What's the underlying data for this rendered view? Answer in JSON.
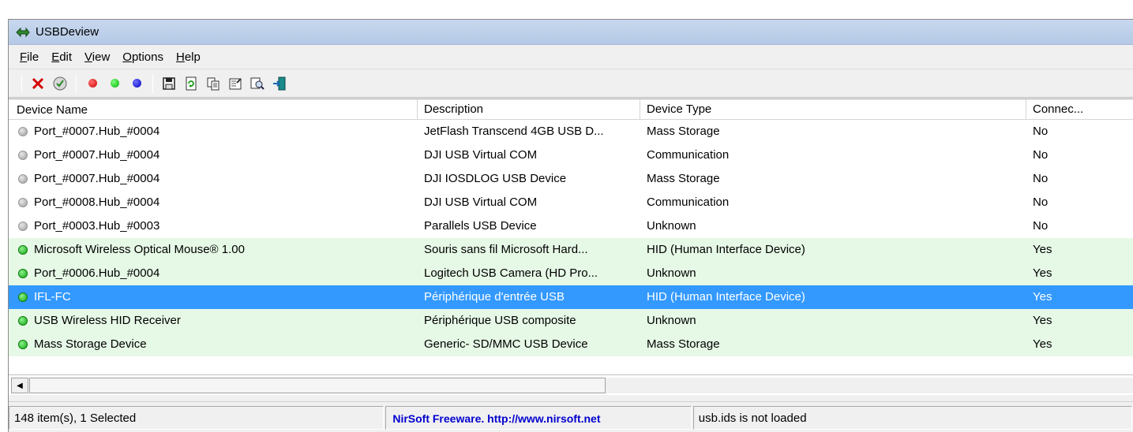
{
  "window": {
    "title": "USBDeview"
  },
  "menu": [
    "File",
    "Edit",
    "View",
    "Options",
    "Help"
  ],
  "menu_accels": [
    "F",
    "E",
    "V",
    "O",
    "H"
  ],
  "toolbar": [
    {
      "name": "uninstall-icon"
    },
    {
      "name": "disable-icon"
    },
    {
      "name": "red-dot-icon",
      "color": "#e00000"
    },
    {
      "name": "green-dot-icon",
      "color": "#00cc00"
    },
    {
      "name": "blue-dot-icon",
      "color": "#0000d0"
    },
    {
      "name": "save-icon"
    },
    {
      "name": "refresh-icon"
    },
    {
      "name": "copy-icon"
    },
    {
      "name": "properties-icon"
    },
    {
      "name": "find-icon"
    },
    {
      "name": "exit-icon"
    }
  ],
  "columns": [
    "Device Name",
    "Description",
    "Device Type",
    "Connec..."
  ],
  "rows": [
    {
      "name": "Port_#0007.Hub_#0004",
      "description": "JetFlash Transcend 4GB USB D...",
      "type": "Mass Storage",
      "connected": "No",
      "state": "gray"
    },
    {
      "name": "Port_#0007.Hub_#0004",
      "description": "DJI USB Virtual COM",
      "type": "Communication",
      "connected": "No",
      "state": "gray"
    },
    {
      "name": "Port_#0007.Hub_#0004",
      "description": "DJI IOSDLOG USB Device",
      "type": "Mass Storage",
      "connected": "No",
      "state": "gray"
    },
    {
      "name": "Port_#0008.Hub_#0004",
      "description": "DJI USB Virtual COM",
      "type": "Communication",
      "connected": "No",
      "state": "gray"
    },
    {
      "name": "Port_#0003.Hub_#0003",
      "description": "Parallels USB Device",
      "type": "Unknown",
      "connected": "No",
      "state": "gray"
    },
    {
      "name": "Microsoft Wireless Optical Mouse® 1.00",
      "description": "Souris sans fil Microsoft Hard...",
      "type": "HID (Human Interface Device)",
      "connected": "Yes",
      "state": "green"
    },
    {
      "name": "Port_#0006.Hub_#0004",
      "description": "Logitech USB Camera (HD Pro...",
      "type": "Unknown",
      "connected": "Yes",
      "state": "green"
    },
    {
      "name": "IFL-FC",
      "description": "Périphérique d'entrée USB",
      "type": "HID (Human Interface Device)",
      "connected": "Yes",
      "state": "selected"
    },
    {
      "name": "USB Wireless HID Receiver",
      "description": "Périphérique USB composite",
      "type": "Unknown",
      "connected": "Yes",
      "state": "green"
    },
    {
      "name": "Mass Storage Device",
      "description": "Generic- SD/MMC USB Device",
      "type": "Mass Storage",
      "connected": "Yes",
      "state": "green"
    }
  ],
  "status": {
    "count": "148 item(s), 1 Selected",
    "nirsoft": "NirSoft Freeware.  http://www.nirsoft.net",
    "usbids": "usb.ids is not loaded"
  }
}
